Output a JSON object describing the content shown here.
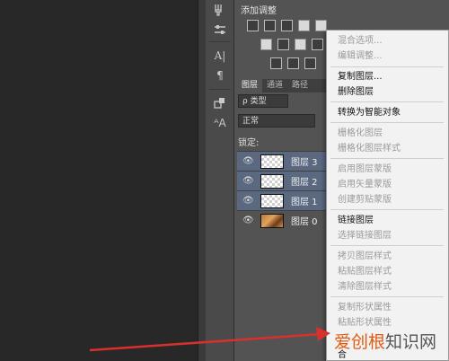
{
  "adjustments": {
    "title": "添加调整"
  },
  "layers_panel": {
    "tabs": [
      "图层",
      "通道",
      "路径"
    ],
    "filter_kind": "ρ 类型",
    "blend_mode": "正常",
    "lock_label": "锁定:",
    "layers": [
      {
        "name": "图层 3",
        "visible": true,
        "thumb": "transparent",
        "selected": true
      },
      {
        "name": "图层 2",
        "visible": true,
        "thumb": "transparent",
        "selected": true
      },
      {
        "name": "图层 1",
        "visible": true,
        "thumb": "transparent",
        "selected": true
      },
      {
        "name": "图层 0",
        "visible": true,
        "thumb": "photo",
        "selected": false
      }
    ]
  },
  "context_menu": {
    "items": [
      {
        "label": "混合选项...",
        "enabled": false
      },
      {
        "label": "编辑调整...",
        "enabled": false
      },
      {
        "label": "复制图层...",
        "enabled": true
      },
      {
        "label": "删除图层",
        "enabled": true
      },
      {
        "label": "转换为智能对象",
        "enabled": true
      },
      {
        "label": "栅格化图层",
        "enabled": false
      },
      {
        "label": "栅格化图层样式",
        "enabled": false
      },
      {
        "label": "启用图层蒙版",
        "enabled": false
      },
      {
        "label": "启用矢量蒙版",
        "enabled": false
      },
      {
        "label": "创建剪贴蒙版",
        "enabled": false
      },
      {
        "label": "链接图层",
        "enabled": true
      },
      {
        "label": "选择链接图层",
        "enabled": false
      },
      {
        "label": "拷贝图层样式",
        "enabled": false
      },
      {
        "label": "粘贴图层样式",
        "enabled": false
      },
      {
        "label": "清除图层样式",
        "enabled": false
      },
      {
        "label": "复制形状属性",
        "enabled": false
      },
      {
        "label": "粘贴形状属性",
        "enabled": false
      },
      {
        "label": "合",
        "enabled": true
      }
    ]
  },
  "watermark": {
    "text_orange": "爱创根",
    "text_gray": "知识网"
  },
  "colors": {
    "arrow": "#d9302c",
    "selection": "#5a6880",
    "panel": "#535353"
  }
}
